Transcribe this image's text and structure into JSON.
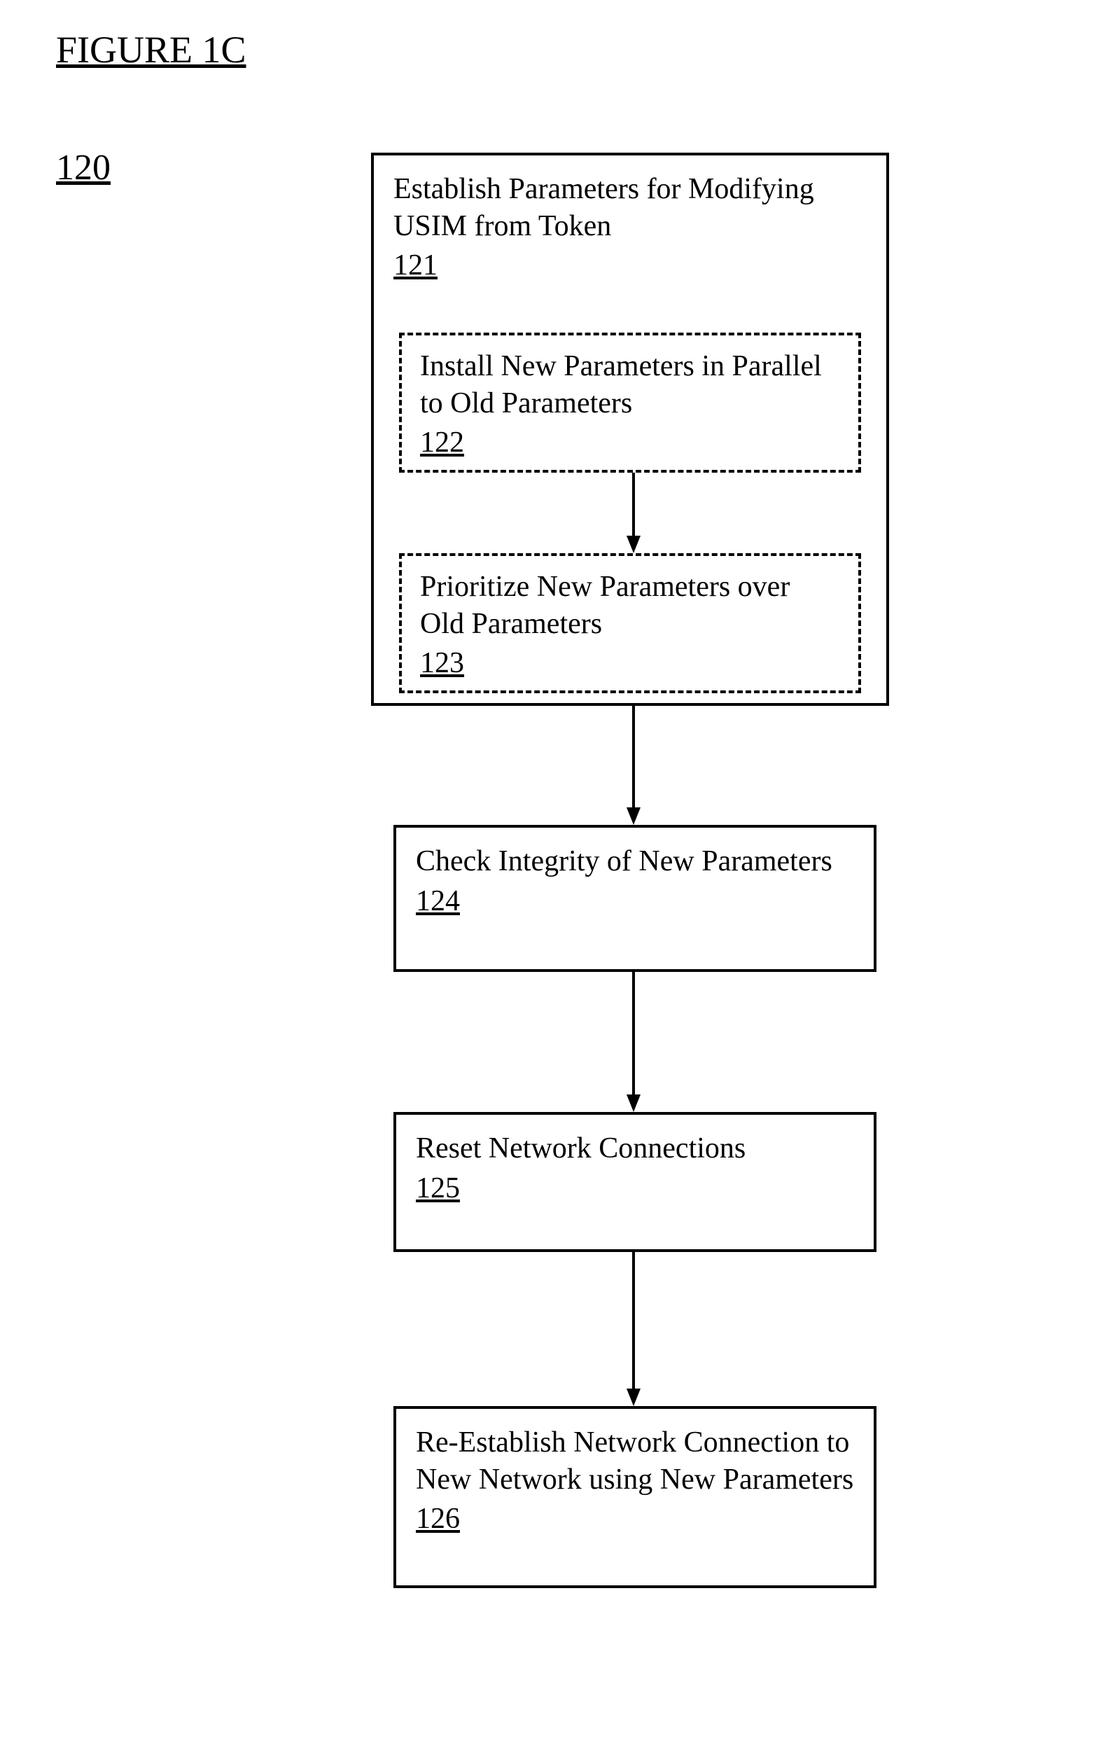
{
  "figure": {
    "title": "FIGURE 1C",
    "ref": "120"
  },
  "boxes": {
    "b121": {
      "text": "Establish Parameters for Modifying USIM from Token",
      "num": "121"
    },
    "b122": {
      "text": "Install New Parameters in Parallel to Old Parameters",
      "num": "122"
    },
    "b123": {
      "text": "Prioritize New Parameters over Old Parameters",
      "num": "123"
    },
    "b124": {
      "text": "Check Integrity of New Parameters",
      "num": "124"
    },
    "b125": {
      "text": "Reset Network Connections",
      "num": "125"
    },
    "b126": {
      "text": "Re-Establish Network Connection to New Network using New Parameters",
      "num": "126"
    }
  }
}
